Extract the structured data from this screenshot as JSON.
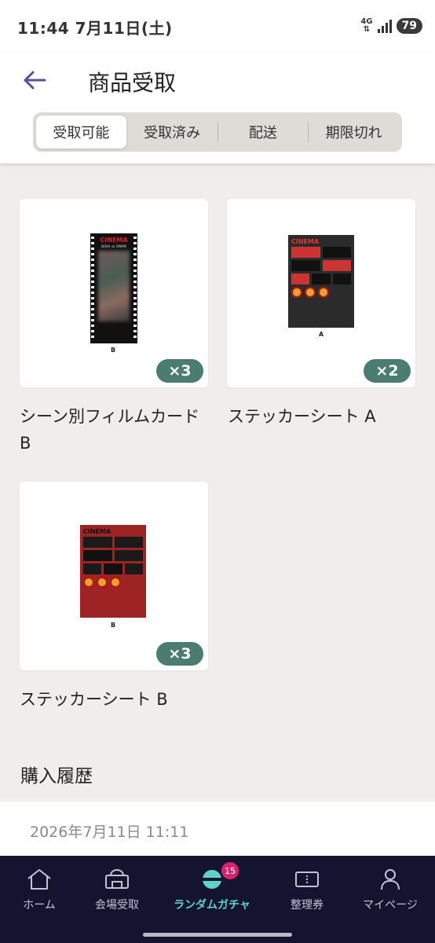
{
  "status_bar": {
    "time": "11:44  7月11日(土)",
    "network": "4G",
    "battery": "79"
  },
  "header": {
    "title": "商品受取"
  },
  "tabs": [
    {
      "label": "受取可能",
      "active": true
    },
    {
      "label": "受取済み",
      "active": false
    },
    {
      "label": "配送",
      "active": false
    },
    {
      "label": "期限切れ",
      "active": false
    }
  ],
  "items": [
    {
      "name": "シーン別フィルムカード B",
      "quantity": "×3",
      "image_caption": "B",
      "image_logo": "CINEMA",
      "image_sub": "SEKAI no OWARI"
    },
    {
      "name": "ステッカーシート A",
      "quantity": "×2",
      "image_caption": "A",
      "image_logo": "CINEMA"
    },
    {
      "name": "ステッカーシート B",
      "quantity": "×3",
      "image_caption": "B",
      "image_logo": "CINEMA"
    }
  ],
  "history": {
    "title": "購入履歴",
    "entries": [
      {
        "date": "2026年7月11日 11:11"
      }
    ]
  },
  "bottom_nav": [
    {
      "label": "ホーム",
      "icon": "home-icon"
    },
    {
      "label": "会場受取",
      "icon": "venue-icon"
    },
    {
      "label": "ランダムガチャ",
      "icon": "gacha-icon",
      "active": true,
      "badge": "15"
    },
    {
      "label": "整理券",
      "icon": "ticket-icon"
    },
    {
      "label": "マイページ",
      "icon": "person-icon"
    }
  ],
  "colors": {
    "accent": "#5fd4c4",
    "badge": "#d6246e",
    "quantity_badge": "#4a7c6f",
    "nav_bg": "#141431",
    "back_arrow": "#5b4f9a"
  }
}
